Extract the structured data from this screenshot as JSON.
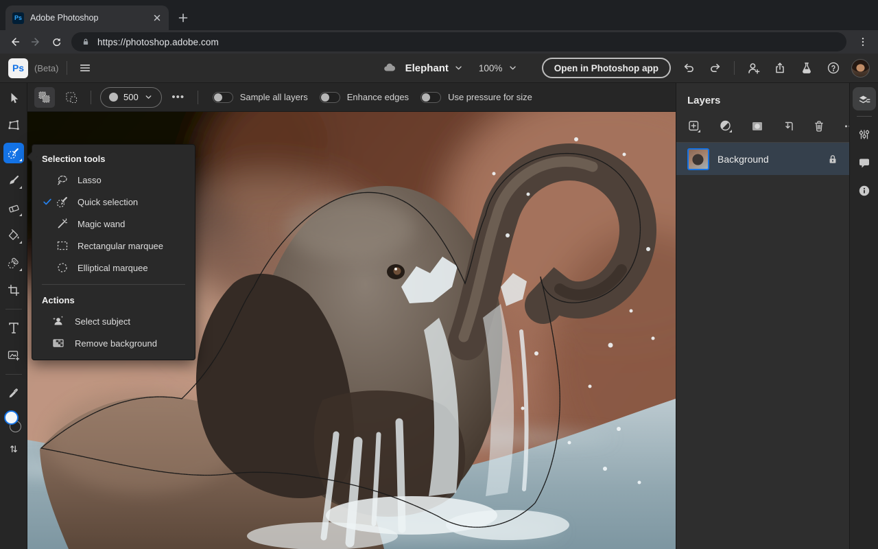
{
  "browser": {
    "tab_title": "Adobe Photoshop",
    "url": "https://photoshop.adobe.com"
  },
  "header": {
    "logo_text": "Ps",
    "beta_label": "(Beta)",
    "doc_name": "Elephant",
    "zoom_value": "100%",
    "open_app_button": "Open in Photoshop app"
  },
  "options_bar": {
    "brush_size": "500",
    "more_label": "•••",
    "toggles": [
      {
        "label": "Sample all layers",
        "on": false
      },
      {
        "label": "Enhance edges",
        "on": false
      },
      {
        "label": "Use pressure for size",
        "on": false
      }
    ]
  },
  "tool_rail": {
    "selected_tool": "quick-selection",
    "tools": [
      "move",
      "transform",
      "quick-selection",
      "brush",
      "eraser",
      "fill",
      "healing-brush",
      "crop",
      "type",
      "place-image",
      "eyedropper",
      "color-swatches",
      "swap-colors"
    ]
  },
  "flyout": {
    "sections": [
      {
        "title": "Selection tools",
        "items": [
          {
            "label": "Lasso",
            "checked": false
          },
          {
            "label": "Quick selection",
            "checked": true
          },
          {
            "label": "Magic wand",
            "checked": false
          },
          {
            "label": "Rectangular marquee",
            "checked": false
          },
          {
            "label": "Elliptical marquee",
            "checked": false
          }
        ]
      },
      {
        "title": "Actions",
        "items": [
          {
            "label": "Select subject",
            "checked": false
          },
          {
            "label": "Remove background",
            "checked": false
          }
        ]
      }
    ]
  },
  "layers_panel": {
    "title": "Layers",
    "layers": [
      {
        "name": "Background",
        "locked": true,
        "selected": true
      }
    ]
  },
  "colors": {
    "accent_blue": "#1473e6",
    "check_blue": "#2680eb",
    "selected_layer_row": "#35404c"
  }
}
